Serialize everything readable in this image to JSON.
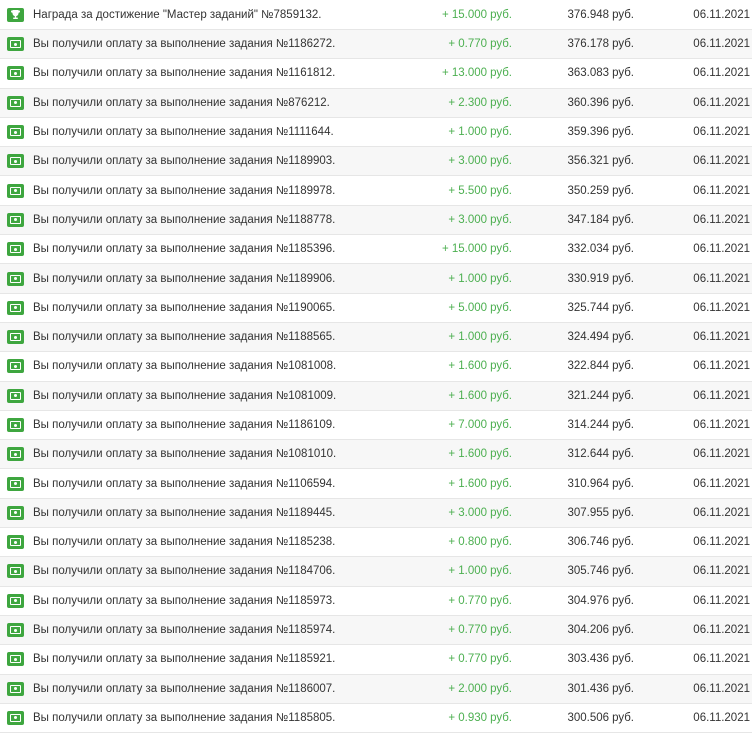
{
  "currency": "руб.",
  "colors": {
    "icon_green": "#3ea63f",
    "amount_green": "#4caf50"
  },
  "rows": [
    {
      "icon": "trophy-icon",
      "description": "Награда за достижение \"Мастер заданий\" №7859132.",
      "amount": "+ 15.000",
      "balance": "376.948",
      "date": "06.11.2021"
    },
    {
      "icon": "money-icon",
      "description": "Вы получили оплату за выполнение задания №1186272.",
      "amount": "+ 0.770",
      "balance": "376.178",
      "date": "06.11.2021"
    },
    {
      "icon": "money-icon",
      "description": "Вы получили оплату за выполнение задания №1161812.",
      "amount": "+ 13.000",
      "balance": "363.083",
      "date": "06.11.2021"
    },
    {
      "icon": "money-icon",
      "description": "Вы получили оплату за выполнение задания №876212.",
      "amount": "+ 2.300",
      "balance": "360.396",
      "date": "06.11.2021"
    },
    {
      "icon": "money-icon",
      "description": "Вы получили оплату за выполнение задания №1111644.",
      "amount": "+ 1.000",
      "balance": "359.396",
      "date": "06.11.2021"
    },
    {
      "icon": "money-icon",
      "description": "Вы получили оплату за выполнение задания №1189903.",
      "amount": "+ 3.000",
      "balance": "356.321",
      "date": "06.11.2021"
    },
    {
      "icon": "money-icon",
      "description": "Вы получили оплату за выполнение задания №1189978.",
      "amount": "+ 5.500",
      "balance": "350.259",
      "date": "06.11.2021"
    },
    {
      "icon": "money-icon",
      "description": "Вы получили оплату за выполнение задания №1188778.",
      "amount": "+ 3.000",
      "balance": "347.184",
      "date": "06.11.2021"
    },
    {
      "icon": "money-icon",
      "description": "Вы получили оплату за выполнение задания №1185396.",
      "amount": "+ 15.000",
      "balance": "332.034",
      "date": "06.11.2021"
    },
    {
      "icon": "money-icon",
      "description": "Вы получили оплату за выполнение задания №1189906.",
      "amount": "+ 1.000",
      "balance": "330.919",
      "date": "06.11.2021"
    },
    {
      "icon": "money-icon",
      "description": "Вы получили оплату за выполнение задания №1190065.",
      "amount": "+ 5.000",
      "balance": "325.744",
      "date": "06.11.2021"
    },
    {
      "icon": "money-icon",
      "description": "Вы получили оплату за выполнение задания №1188565.",
      "amount": "+ 1.000",
      "balance": "324.494",
      "date": "06.11.2021"
    },
    {
      "icon": "money-icon",
      "description": "Вы получили оплату за выполнение задания №1081008.",
      "amount": "+ 1.600",
      "balance": "322.844",
      "date": "06.11.2021"
    },
    {
      "icon": "money-icon",
      "description": "Вы получили оплату за выполнение задания №1081009.",
      "amount": "+ 1.600",
      "balance": "321.244",
      "date": "06.11.2021"
    },
    {
      "icon": "money-icon",
      "description": "Вы получили оплату за выполнение задания №1186109.",
      "amount": "+ 7.000",
      "balance": "314.244",
      "date": "06.11.2021"
    },
    {
      "icon": "money-icon",
      "description": "Вы получили оплату за выполнение задания №1081010.",
      "amount": "+ 1.600",
      "balance": "312.644",
      "date": "06.11.2021"
    },
    {
      "icon": "money-icon",
      "description": "Вы получили оплату за выполнение задания №1106594.",
      "amount": "+ 1.600",
      "balance": "310.964",
      "date": "06.11.2021"
    },
    {
      "icon": "money-icon",
      "description": "Вы получили оплату за выполнение задания №1189445.",
      "amount": "+ 3.000",
      "balance": "307.955",
      "date": "06.11.2021"
    },
    {
      "icon": "money-icon",
      "description": "Вы получили оплату за выполнение задания №1185238.",
      "amount": "+ 0.800",
      "balance": "306.746",
      "date": "06.11.2021"
    },
    {
      "icon": "money-icon",
      "description": "Вы получили оплату за выполнение задания №1184706.",
      "amount": "+ 1.000",
      "balance": "305.746",
      "date": "06.11.2021"
    },
    {
      "icon": "money-icon",
      "description": "Вы получили оплату за выполнение задания №1185973.",
      "amount": "+ 0.770",
      "balance": "304.976",
      "date": "06.11.2021"
    },
    {
      "icon": "money-icon",
      "description": "Вы получили оплату за выполнение задания №1185974.",
      "amount": "+ 0.770",
      "balance": "304.206",
      "date": "06.11.2021"
    },
    {
      "icon": "money-icon",
      "description": "Вы получили оплату за выполнение задания №1185921.",
      "amount": "+ 0.770",
      "balance": "303.436",
      "date": "06.11.2021"
    },
    {
      "icon": "money-icon",
      "description": "Вы получили оплату за выполнение задания №1186007.",
      "amount": "+ 2.000",
      "balance": "301.436",
      "date": "06.11.2021"
    },
    {
      "icon": "money-icon",
      "description": "Вы получили оплату за выполнение задания №1185805.",
      "amount": "+ 0.930",
      "balance": "300.506",
      "date": "06.11.2021"
    }
  ]
}
